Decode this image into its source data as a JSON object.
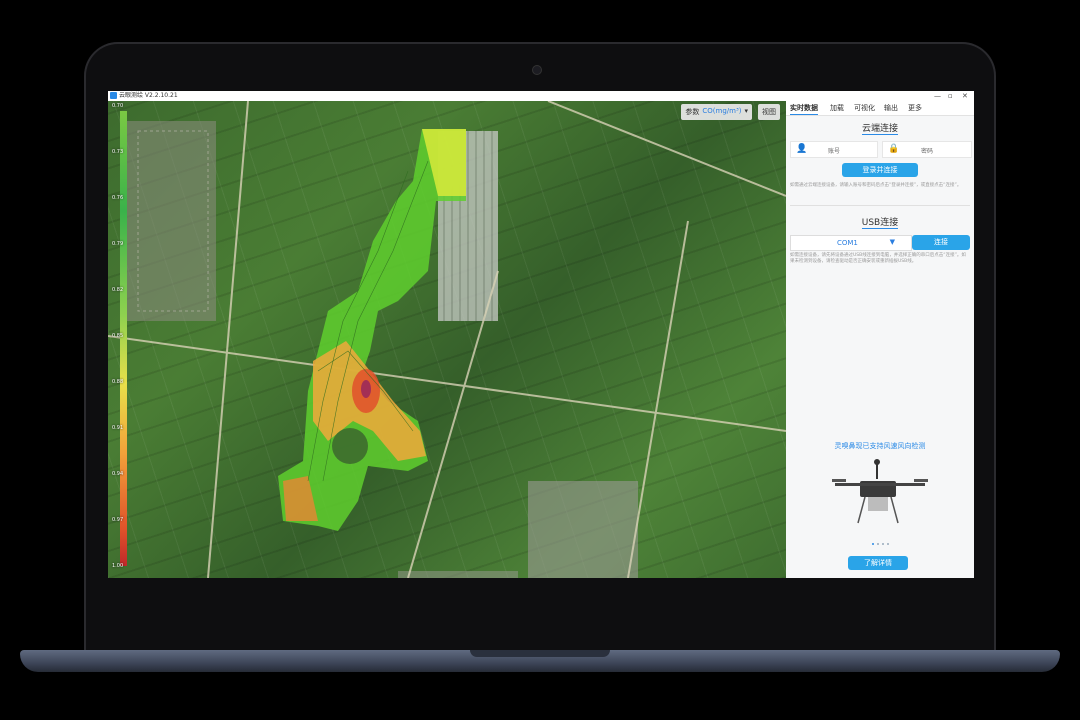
{
  "app": {
    "title": "云眼测绘 V2.2.10.21"
  },
  "window_controls": [
    "—",
    "▫",
    "✕"
  ],
  "map": {
    "param_label": "参数",
    "param_value": "CO(mg/m³)",
    "view_label": "视图",
    "colorbar_ticks": [
      "0.70",
      "0.73",
      "0.76",
      "0.79",
      "0.82",
      "0.85",
      "0.88",
      "0.91",
      "0.94",
      "0.97",
      "1.00"
    ]
  },
  "panel": {
    "tabs": [
      "实时数据",
      "加载",
      "可视化",
      "输出",
      "更多"
    ],
    "cloud": {
      "title": "云端连接",
      "account_placeholder": "账号",
      "password_placeholder": "密码",
      "login_button": "登录并连接",
      "note": "如需通过云端连接设备，请输入账号和密码后点击“登录并连接”，或直接点击“连接”。"
    },
    "usb": {
      "title": "USB连接",
      "port_value": "COM1",
      "connect_button": "连接",
      "note": "如需连接设备，请先将设备通过USB线连接到电脑，并选择正确的串口后点击“连接”。如果未检测到设备，请检查驱动是否正确安装或重新插拔USB线。"
    },
    "promo": {
      "text": "灵嗅鼻现已支持风速风向检测",
      "button": "了解详情"
    }
  },
  "colors": {
    "accent": "#2aa4e8",
    "tab_underline": "#2a8ae6"
  }
}
